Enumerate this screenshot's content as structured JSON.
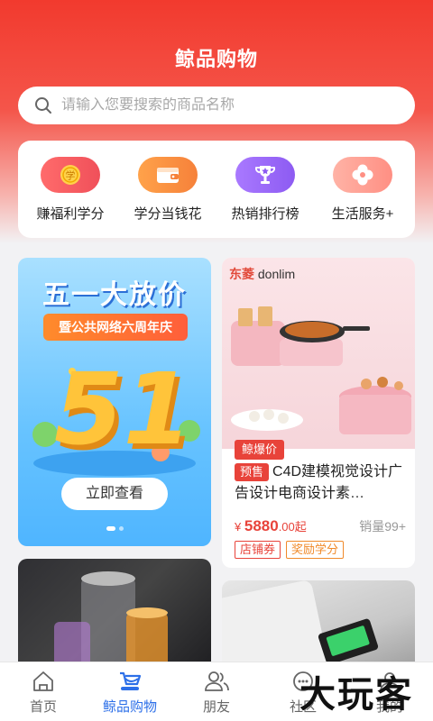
{
  "header": {
    "title": "鲸品购物"
  },
  "search": {
    "placeholder": "请输入您要搜索的商品名称"
  },
  "quick_actions": [
    {
      "label": "赚福利学分",
      "icon": "coin-icon",
      "color": "#f0505a"
    },
    {
      "label": "学分当钱花",
      "icon": "wallet-icon",
      "color": "#f6813a"
    },
    {
      "label": "热销排行榜",
      "icon": "trophy-icon",
      "color": "#8d5bf2"
    },
    {
      "label": "生活服务+",
      "icon": "clover-icon",
      "color": "#ff8f83"
    }
  ],
  "banner": {
    "title": "五一大放价",
    "subtitle": "暨公共网络六周年庆",
    "big_text": "51",
    "button": "立即查看",
    "dots": 2,
    "active_dot": 0
  },
  "product": {
    "brand_cn": "东菱",
    "brand_en": "donlim",
    "hot_tag": "鲸爆价",
    "presale_tag": "预售",
    "name": "C4D建模视觉设计广告设计电商设计素…",
    "price_symbol": "¥",
    "price_int": "5880",
    "price_dec": ".00起",
    "sales": "销量99+",
    "coupons": [
      "店铺券",
      "奖励学分"
    ]
  },
  "tabbar": [
    {
      "label": "首页",
      "icon": "home-icon",
      "active": false
    },
    {
      "label": "鲸品购物",
      "icon": "cart-icon",
      "active": true
    },
    {
      "label": "朋友",
      "icon": "friends-icon",
      "active": false
    },
    {
      "label": "社区",
      "icon": "community-icon",
      "active": false
    },
    {
      "label": "我的",
      "icon": "profile-icon",
      "active": false
    }
  ],
  "watermark": "大玩客",
  "colors": {
    "accent": "#e8433a",
    "tab_active": "#2c6fe8"
  }
}
